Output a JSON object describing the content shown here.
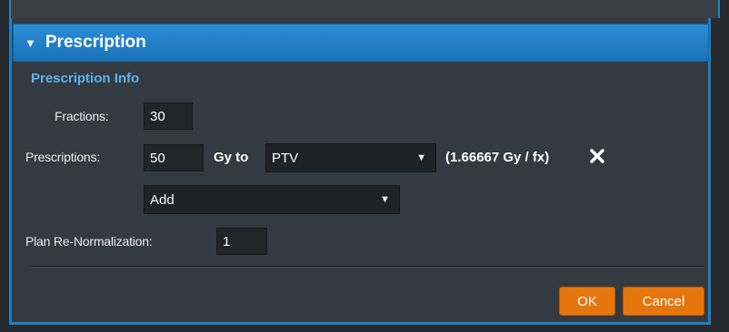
{
  "panel": {
    "title": "Prescription",
    "section_title": "Prescription Info"
  },
  "fractions": {
    "label": "Fractions:",
    "value": "30"
  },
  "prescriptions": {
    "label": "Prescriptions:",
    "dose_value": "50",
    "dose_unit_text": "Gy to",
    "structure_selected": "PTV",
    "per_fraction_text": "(1.66667 Gy / fx)"
  },
  "add_select": {
    "selected": "Add"
  },
  "renormalization": {
    "label": "Plan Re-Normalization:",
    "value": "1"
  },
  "buttons": {
    "ok": "OK",
    "cancel": "Cancel"
  },
  "colors": {
    "header_blue": "#1f7fc6",
    "section_title": "#5ab3ef",
    "button_orange": "#e5750d",
    "panel_bg": "#343a41"
  },
  "icons": {
    "collapse": "triangle-down-icon",
    "remove": "close-icon",
    "dropdown": "chevron-down-icon"
  }
}
